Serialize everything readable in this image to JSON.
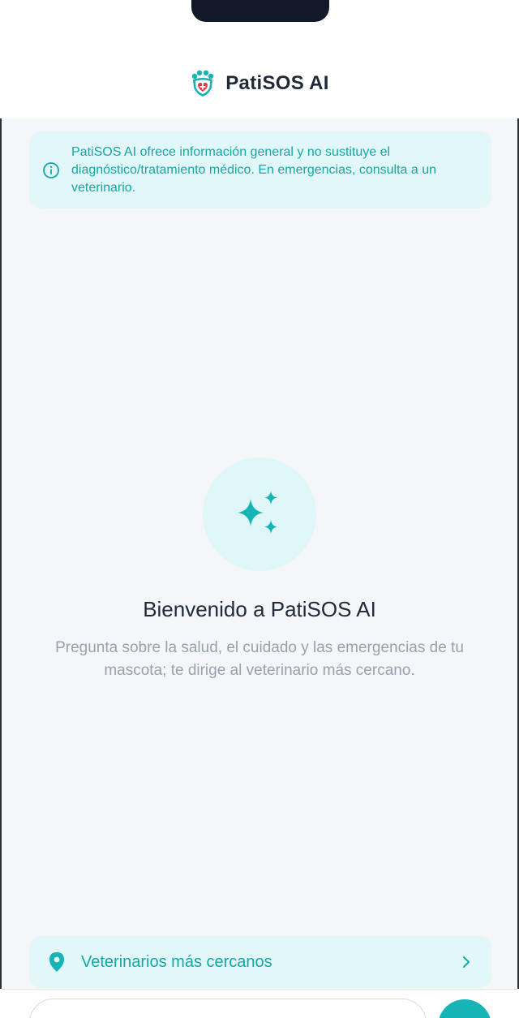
{
  "header": {
    "app_name": "PatiSOS AI",
    "logo_icon": "paw-shield-icon"
  },
  "disclaimer": {
    "icon": "info-icon",
    "text": "PatiSOS AI ofrece información general y no sustituye el diagnóstico/tratamiento médico. En emergencias, consulta a un veterinario."
  },
  "welcome": {
    "icon": "sparkles-icon",
    "title": "Bienvenido a PatiSOS AI",
    "subtitle": "Pregunta sobre la salud, el cuidado y las emergencias de tu mascota; te dirige al veterinario más cercano."
  },
  "nearest_vets": {
    "icon": "location-pin-icon",
    "label": "Veterinarios más cercanos",
    "chevron": "chevron-right-icon"
  },
  "composer": {
    "input_value": "",
    "send_icon": "send-icon"
  },
  "colors": {
    "accent": "#16b4b4",
    "accent_text": "#15a6a6",
    "accent_bg": "#e2f8f8",
    "page_bg": "#f4f6f9",
    "title_text": "#1f2937",
    "muted_text": "#9aa1ab"
  }
}
